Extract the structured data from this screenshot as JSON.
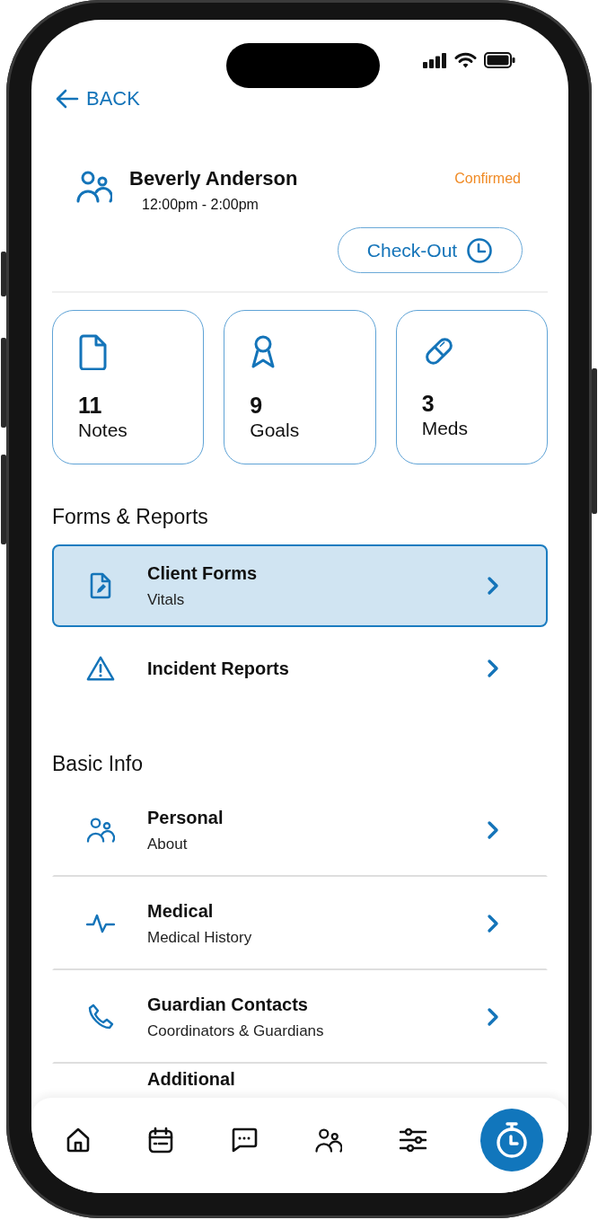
{
  "back": {
    "label": "BACK"
  },
  "client": {
    "name": "Beverly Anderson",
    "time": "12:00pm - 2:00pm",
    "status": "Confirmed"
  },
  "check_out": {
    "label": "Check-Out"
  },
  "stats": [
    {
      "count": "11",
      "label": "Notes"
    },
    {
      "count": "9",
      "label": "Goals"
    },
    {
      "count": "3",
      "label": "Meds"
    }
  ],
  "sections": [
    {
      "title": "Forms & Reports",
      "items": [
        {
          "title": "Client Forms",
          "subtitle": "Vitals",
          "selected": true,
          "divider": false
        },
        {
          "title": "Incident Reports",
          "selected": false,
          "divider": false
        }
      ]
    },
    {
      "title": "Basic Info",
      "items": [
        {
          "title": "Personal",
          "subtitle": "About",
          "selected": false,
          "divider": true
        },
        {
          "title": "Medical",
          "subtitle": "Medical History",
          "selected": false,
          "divider": true
        },
        {
          "title": "Guardian Contacts",
          "subtitle": "Coordinators & Guardians",
          "selected": false,
          "divider": true
        },
        {
          "title": "Additional",
          "selected": false,
          "divider": false
        }
      ]
    }
  ],
  "nav": [
    {
      "kind": "tab"
    },
    {
      "kind": "tab"
    },
    {
      "kind": "tab"
    },
    {
      "kind": "tab"
    },
    {
      "kind": "tab"
    },
    {
      "kind": "action"
    }
  ]
}
